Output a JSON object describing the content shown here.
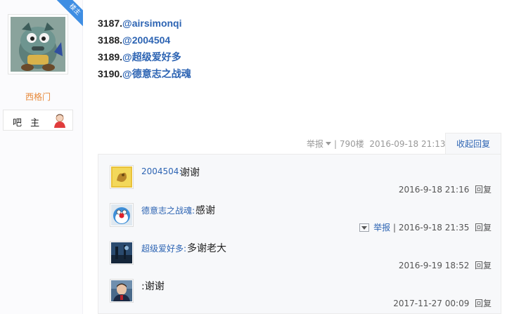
{
  "author": {
    "badge": "楼主",
    "name": "西格门",
    "role": "吧 主"
  },
  "post": {
    "lines": [
      {
        "num": "3187.",
        "mention": "@airsimonqi"
      },
      {
        "num": "3188.",
        "mention": "@2004504"
      },
      {
        "num": "3189.",
        "mention": "@超级爱好多"
      },
      {
        "num": "3190.",
        "mention": "@德意志之战魂"
      }
    ],
    "meta": {
      "report": "举报",
      "floor": "| 790楼",
      "time": "2016-09-18 21:13"
    },
    "collapse_label": "收起回复"
  },
  "replies": [
    {
      "author": "2004504:",
      "text": "谢谢",
      "report": "",
      "time": "2016-9-18 21:16",
      "reply_label": "回复"
    },
    {
      "author": "德意志之战魂:",
      "text": "感谢",
      "report": "举报",
      "time": "| 2016-9-18 21:35",
      "reply_label": "回复"
    },
    {
      "author": "超级爱好多:",
      "text": "多谢老大",
      "report": "",
      "time": "2016-9-19 18:52",
      "reply_label": "回复"
    },
    {
      "author": "",
      "text": ":谢谢",
      "report": "",
      "time": "2017-11-27 00:09",
      "reply_label": "回复"
    }
  ],
  "colors": {
    "link": "#2d64b3",
    "username": "#e7893a",
    "badge": "#3f8ee3",
    "panel_bg": "#f7f8fa"
  }
}
